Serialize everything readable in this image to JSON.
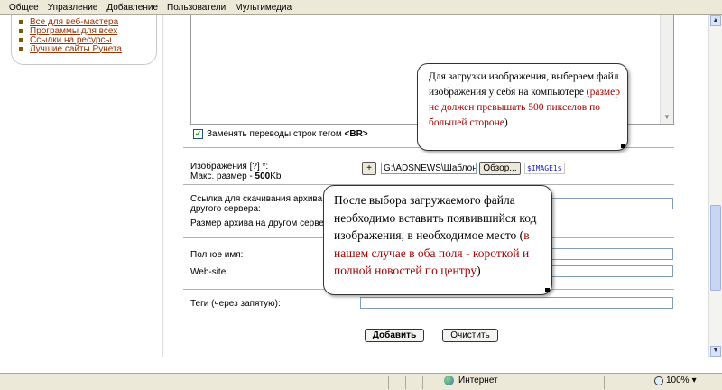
{
  "topnav": [
    "Общее",
    "Управление",
    "Добавление",
    "Пользователи",
    "Мультимедиа"
  ],
  "sidebar": {
    "links": [
      "Все для веб-мастера",
      "Программы для всех",
      "Ссылки на ресурсы",
      "Лучшие сайты Рунета"
    ]
  },
  "form": {
    "replace_newlines_label_prefix": "Заменять переводы строк тегом ",
    "replace_newlines_tag": "<BR>",
    "replace_newlines_checked": true,
    "images_label": "Изображения [?] *:",
    "max_size_label": "Макс. размер - ",
    "max_size_value": "500",
    "max_size_unit": "Kb",
    "plus_button": "+",
    "file_path": "G:\\ADSNEWS\\Шаблоны",
    "browse_button": "Обзор...",
    "image_code": "$IMAGE1$",
    "archive_link_label_1": "Ссылка для скачивания архива",
    "archive_link_label_2": "другого сервера:",
    "archive_size_label": "Размер архива на другом серве",
    "fullname_label": "Полное имя:",
    "website_label": "Web-site:",
    "tags_label": "Теги (через запятую):",
    "add_button": "Добавить",
    "clear_button": "Очистить"
  },
  "callouts": {
    "first": {
      "text": "Для загрузки изображения, выбераем файл изображения у себя на компьютере (",
      "highlight": "размер не должен превышать 500 пикселов по большей стороне",
      "tail": ")"
    },
    "second": {
      "text": "После выбора загружаемого файла необходимо вставить появившийся код изображения, в необходимое место (",
      "highlight": "в нашем случае в оба поля - короткой и полной новостей по центру",
      "tail": ")"
    }
  },
  "statusbar": {
    "zone": "Интернет",
    "zoom": "100%"
  },
  "colors": {
    "link": "#993300",
    "highlight": "#a40000",
    "code": "#1e1ec8"
  }
}
